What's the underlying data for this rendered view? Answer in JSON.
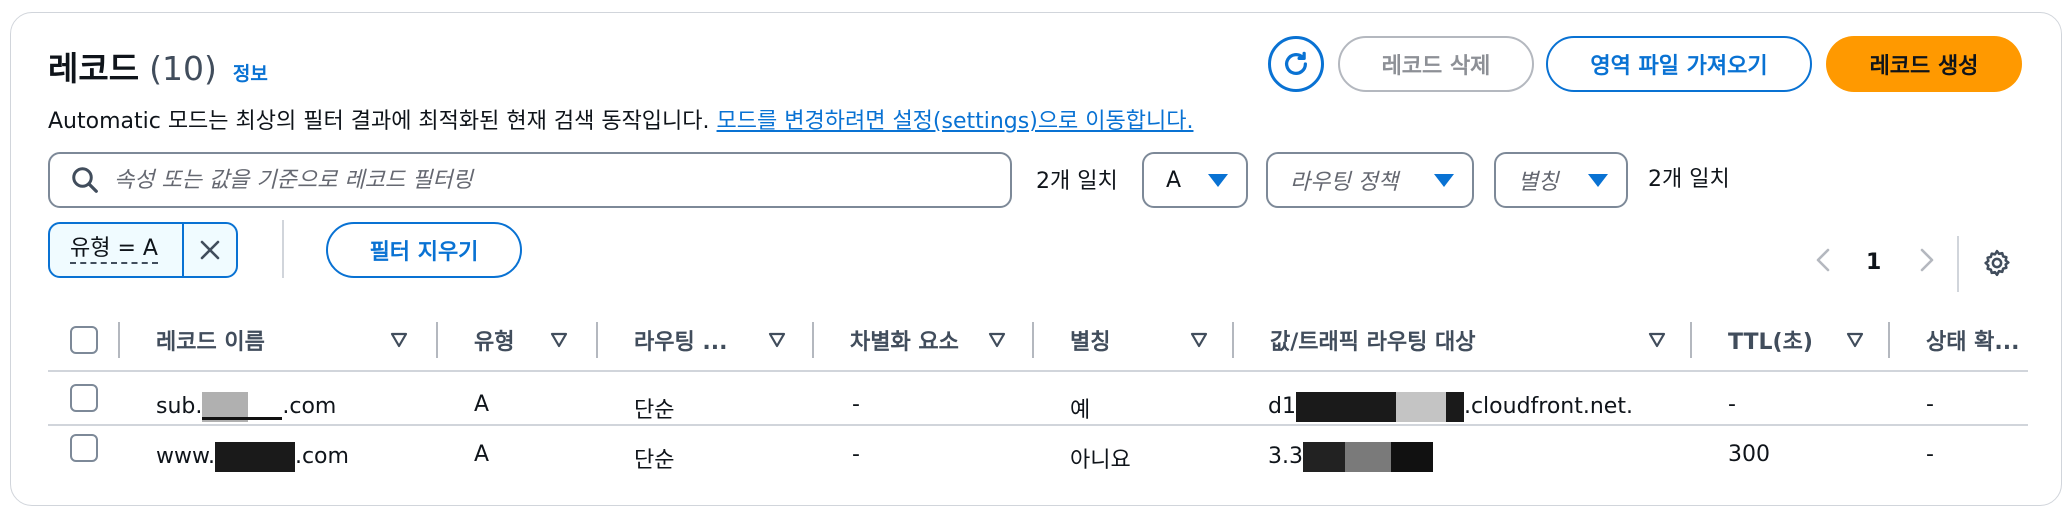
{
  "header": {
    "title": "레코드",
    "count": "(10)",
    "info_link": "정보",
    "description": "Automatic 모드는 최상의 필터 결과에 최적화된 현재 검색 동작입니다.",
    "description_link": "모드를 변경하려면 설정(settings)으로 이동합니다."
  },
  "actions": {
    "refresh_icon": "refresh-icon",
    "delete_label": "레코드 삭제",
    "import_label": "영역 파일 가져오기",
    "create_label": "레코드 생성"
  },
  "filter": {
    "search_placeholder": "속성 또는 값을 기준으로 레코드 필터링",
    "search_value": "",
    "match_count": "2개 일치",
    "type_select": "A",
    "routing_placeholder": "라우팅 정책",
    "alias_placeholder": "별칭",
    "match_count_2": "2개 일치",
    "token_label": "유형 = A",
    "clear_label": "필터 지우기"
  },
  "pagination": {
    "current_page": "1"
  },
  "table": {
    "columns": [
      "레코드 이름",
      "유형",
      "라우팅 ...",
      "차별화 요소",
      "별칭",
      "값/트래픽 라우팅 대상",
      "TTL(초)",
      "상태 확..."
    ],
    "rows": [
      {
        "name_prefix": "sub.",
        "name_suffix": ".com",
        "type": "A",
        "routing": "단순",
        "differentiator": "-",
        "alias": "예",
        "value_prefix": "d1",
        "value_suffix": ".cloudfront.net.",
        "ttl": "-",
        "health": "-"
      },
      {
        "name_prefix": "www.",
        "name_suffix": ".com",
        "type": "A",
        "routing": "단순",
        "differentiator": "-",
        "alias": "아니요",
        "value_prefix": "3.3",
        "value_suffix": "",
        "ttl": "300",
        "health": "-"
      }
    ]
  },
  "colors": {
    "accent": "#0972d3",
    "primary": "#ff9900",
    "disabled": "#8d9096"
  }
}
